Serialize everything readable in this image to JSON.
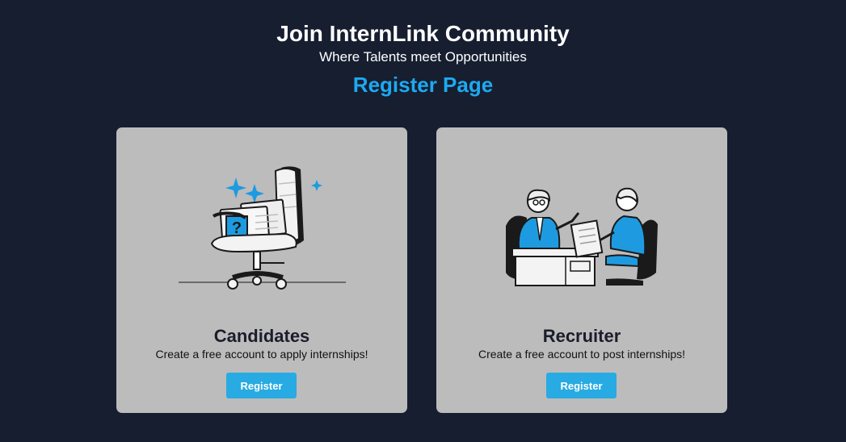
{
  "header": {
    "title": "Join InternLink Community",
    "subtitle": "Where Talents meet Opportunities",
    "page_heading": "Register Page"
  },
  "cards": [
    {
      "title": "Candidates",
      "description": "Create a free account to apply internships!",
      "button_label": "Register",
      "illustration": "empty-chair-question-illustration"
    },
    {
      "title": "Recruiter",
      "description": "Create a free account to post internships!",
      "button_label": "Register",
      "illustration": "interview-meeting-illustration"
    }
  ],
  "colors": {
    "background": "#161e30",
    "accent": "#1ea9f0",
    "card": "#bcbcbc",
    "button": "#28aae2"
  }
}
